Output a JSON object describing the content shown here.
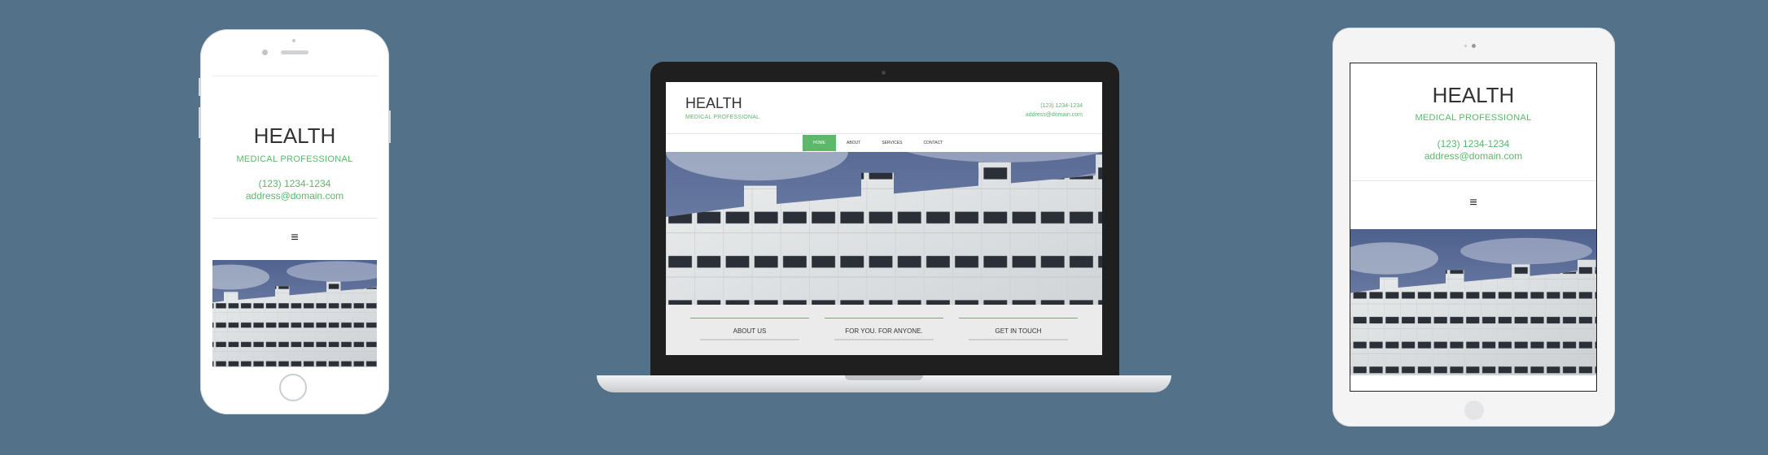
{
  "site": {
    "title": "HEALTH",
    "subtitle": "MEDICAL PROFESSIONAL",
    "phone": "(123) 1234-1234",
    "email": "address@domain.com",
    "menu_glyph": "≡"
  },
  "laptop_site": {
    "phone": "(123) 1234-1234",
    "nav": [
      "HOME",
      "ABOUT",
      "SERVICES",
      "CONTACT"
    ],
    "active_nav": "HOME",
    "sections": [
      "ABOUT US",
      "FOR YOU. FOR ANYONE.",
      "GET IN TOUCH"
    ]
  },
  "icons": {
    "menu": "hamburger-menu-icon",
    "home": "home-button-icon"
  },
  "colors": {
    "background": "#54718a",
    "accent": "#5cb86a",
    "laptop_bezel": "#1f1f1f",
    "sky": "#5b6f9a",
    "building": "#e7e9ea"
  }
}
